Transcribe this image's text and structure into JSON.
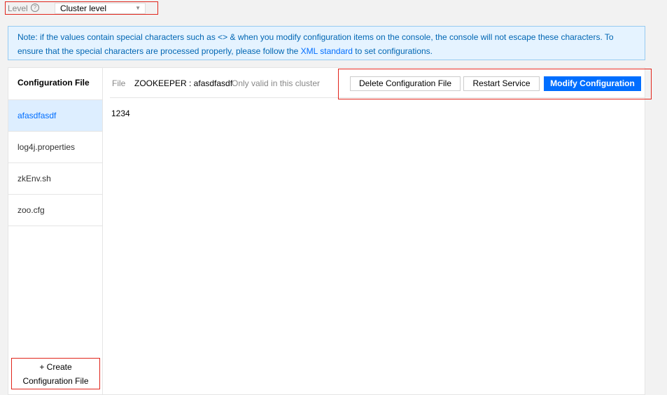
{
  "level": {
    "label": "Level",
    "help_icon": "question-circle-icon",
    "selected": "Cluster level"
  },
  "note": {
    "text_before": "Note: if the values contain special characters such as <> & when you modify configuration items on the console, the console will not escape these characters. To ensure that the special characters are processed properly, please follow the ",
    "link": "XML standard",
    "text_after": " to set configurations."
  },
  "sidebar": {
    "title": "Configuration File",
    "items": [
      {
        "label": "afasdfasdf",
        "active": true
      },
      {
        "label": "log4j.properties",
        "active": false
      },
      {
        "label": "zkEnv.sh",
        "active": false
      },
      {
        "label": "zoo.cfg",
        "active": false
      }
    ],
    "create_line1": "+ Create",
    "create_line2": "Configuration File"
  },
  "file": {
    "label": "File",
    "name": "ZOOKEEPER : afasdfasdf",
    "hint": "Only valid in this cluster",
    "content": "1234"
  },
  "actions": {
    "delete": "Delete Configuration File",
    "restart": "Restart Service",
    "modify": "Modify Configuration"
  },
  "colors": {
    "primary": "#006eff",
    "highlight_border": "#e1251b",
    "note_bg": "#e5f3ff",
    "active_item_bg": "#ddeeff"
  }
}
